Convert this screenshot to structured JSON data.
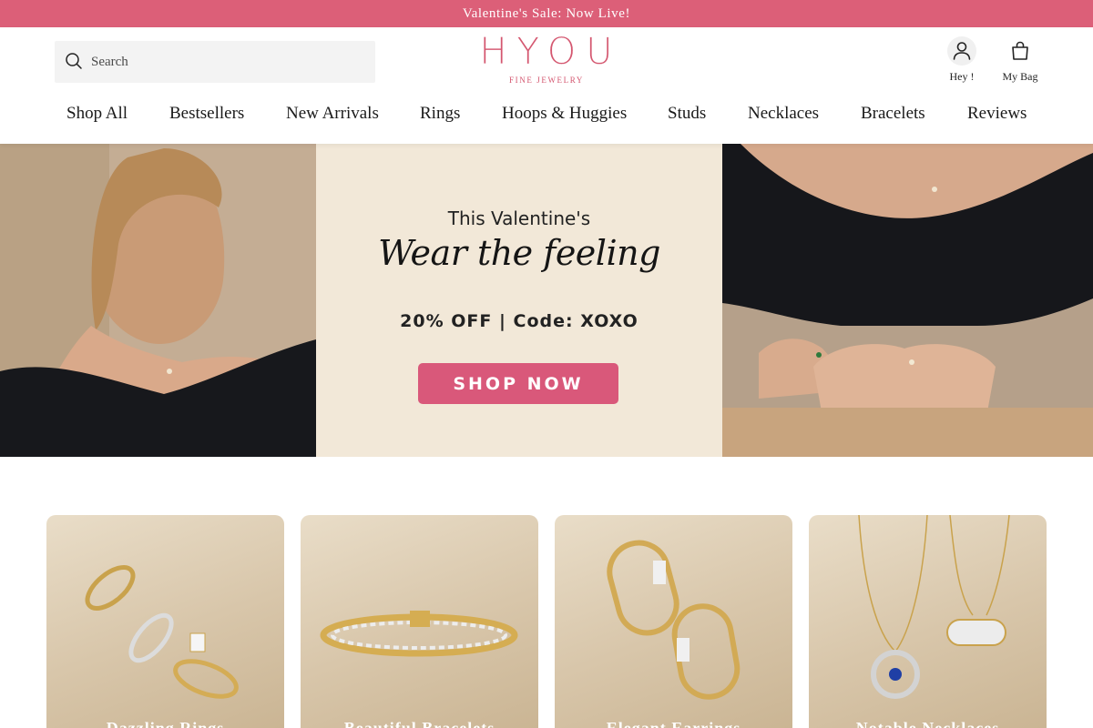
{
  "announcement": {
    "text": "Valentine's Sale: Now Live!"
  },
  "header": {
    "search_placeholder": "Search",
    "logo": "HYOU",
    "logo_sub": "FINE JEWELRY",
    "account_label": "Hey !",
    "bag_label": "My Bag"
  },
  "nav": {
    "items": [
      {
        "label": "Shop All"
      },
      {
        "label": "Bestsellers"
      },
      {
        "label": "New Arrivals"
      },
      {
        "label": "Rings"
      },
      {
        "label": "Hoops & Huggies"
      },
      {
        "label": "Studs"
      },
      {
        "label": "Necklaces"
      },
      {
        "label": "Bracelets"
      },
      {
        "label": "Reviews"
      }
    ]
  },
  "hero": {
    "line1": "This Valentine's",
    "line2": "Wear the feeling",
    "line3": "20% OFF  |  Code: XOXO",
    "cta": "SHOP NOW"
  },
  "categories": [
    {
      "label": "Dazzling Rings"
    },
    {
      "label": "Beautiful Bracelets"
    },
    {
      "label": "Elegant Earrings"
    },
    {
      "label": "Notable Necklaces"
    }
  ],
  "colors": {
    "announcement_bg": "#dc5f78",
    "brand_pink": "#d4566f",
    "cta_bg": "#d9587a",
    "hero_bg": "#f2e8d8"
  },
  "icons": [
    "search-icon",
    "user-icon",
    "shopping-bag-icon"
  ]
}
